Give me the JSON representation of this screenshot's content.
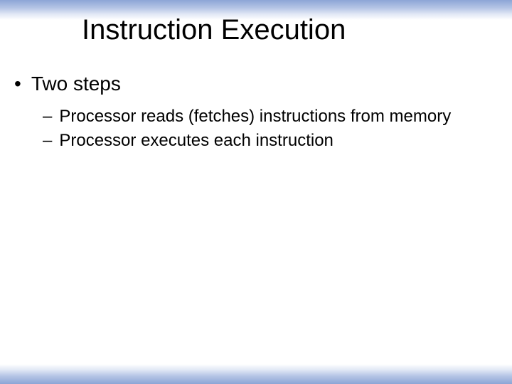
{
  "slide": {
    "title": "Instruction Execution",
    "bullets": [
      {
        "marker": "•",
        "text": "Two steps",
        "children": [
          {
            "marker": "–",
            "text": "Processor reads (fetches) instructions from memory"
          },
          {
            "marker": "–",
            "text": "Processor executes each instruction"
          }
        ]
      }
    ]
  }
}
